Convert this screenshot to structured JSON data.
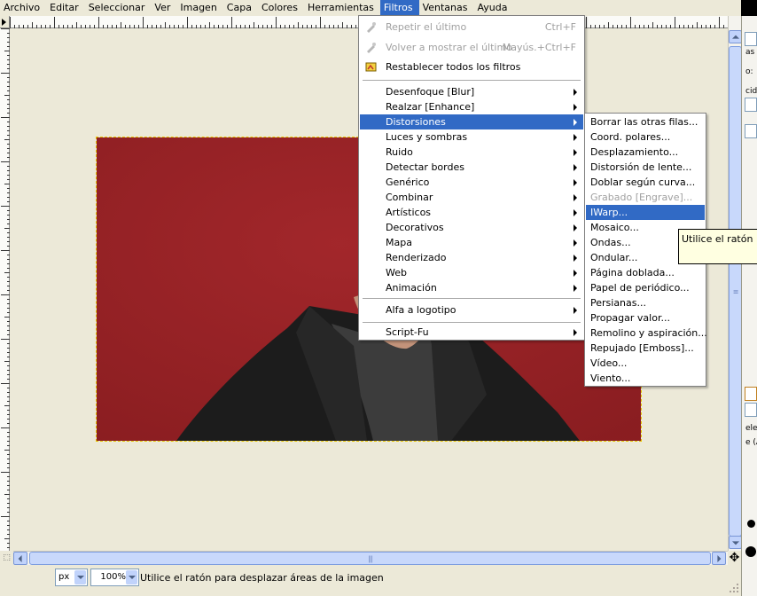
{
  "menubar": [
    {
      "label": "Archivo"
    },
    {
      "label": "Editar"
    },
    {
      "label": "Seleccionar"
    },
    {
      "label": "Ver"
    },
    {
      "label": "Imagen"
    },
    {
      "label": "Capa"
    },
    {
      "label": "Colores"
    },
    {
      "label": "Herramientas"
    },
    {
      "label": "Filtros",
      "active": true
    },
    {
      "label": "Ventanas"
    },
    {
      "label": "Ayuda"
    }
  ],
  "filters_menu": {
    "top": [
      {
        "label": "Repetir el último",
        "accel": "Ctrl+F",
        "disabled": true,
        "icon": "repeat-icon"
      },
      {
        "label": "Volver a mostrar el último",
        "accel": "Mayús.+Ctrl+F",
        "disabled": true,
        "icon": "reshow-icon"
      },
      {
        "label": "Restablecer todos los filtros",
        "accel": "",
        "disabled": false,
        "icon": "reset-icon"
      }
    ],
    "categories": [
      "Desenfoque [Blur]",
      "Realzar [Enhance]",
      "Distorsiones",
      "Luces y sombras",
      "Ruido",
      "Detectar bordes",
      "Genérico",
      "Combinar",
      "Artísticos",
      "Decorativos",
      "Mapa",
      "Renderizado",
      "Web",
      "Animación"
    ],
    "selected_category": "Distorsiones",
    "extra1": "Alfa a logotipo",
    "extra2": "Script-Fu"
  },
  "distortions_submenu": {
    "items": [
      "Borrar las otras filas...",
      "Coord. polares...",
      "Desplazamiento...",
      "Distorsión de lente...",
      "Doblar según curva...",
      "Grabado [Engrave]...",
      "IWarp...",
      "Mosaico...",
      "Ondas...",
      "Ondular...",
      "Página doblada...",
      "Papel de periódico...",
      "Persianas...",
      "Propagar valor...",
      "Remolino y aspiración...",
      "Repujado [Emboss]...",
      "Vídeo...",
      "Viento..."
    ],
    "selected": "IWarp...",
    "disabled": [
      "Grabado [Engrave]..."
    ]
  },
  "tooltip": "Utilice el ratón para",
  "statusbar": {
    "unit": "px",
    "zoom": "100%",
    "message": "Utilice el ratón para desplazar áreas de la imagen"
  },
  "right_panel": {
    "texts": [
      "as",
      "o:",
      "cida",
      "ele",
      "e (A"
    ]
  },
  "colors": {
    "selection_blue": "#316ac5",
    "image_red": "#9b2226",
    "jacket": "#1e1e1e",
    "shirt": "#3f3f3f",
    "skin": "#c99a80"
  }
}
